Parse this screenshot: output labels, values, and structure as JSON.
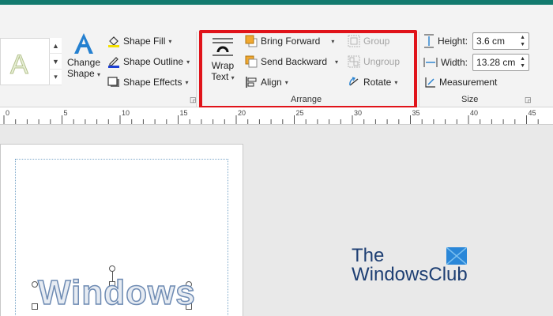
{
  "ribbon": {
    "change_shape": {
      "line1": "Change",
      "line2": "Shape"
    },
    "shape_styles": {
      "fill": "Shape Fill",
      "outline": "Shape Outline",
      "effects": "Shape Effects"
    },
    "arrange": {
      "wrap_text": {
        "line1": "Wrap",
        "line2": "Text"
      },
      "bring_forward": "Bring Forward",
      "send_backward": "Send Backward",
      "align": "Align",
      "group": "Group",
      "ungroup": "Ungroup",
      "rotate": "Rotate",
      "label": "Arrange"
    },
    "size": {
      "height_label": "Height:",
      "height_value": "3.6 cm",
      "width_label": "Width:",
      "width_value": "13.28 cm",
      "measurement": "Measurement",
      "label": "Size"
    }
  },
  "ruler": {
    "ticks": [
      "0",
      "5",
      "10",
      "15",
      "20",
      "25",
      "30",
      "35",
      "40",
      "45"
    ]
  },
  "document": {
    "wordart_text": "Windows"
  },
  "watermark": {
    "line1": "The",
    "line2": "WindowsClub"
  },
  "colors": {
    "title_bar": "#137a6e",
    "highlight": "#e0131a",
    "logo_text": "#1e3f73",
    "logo_accent": "#2a87d8"
  }
}
